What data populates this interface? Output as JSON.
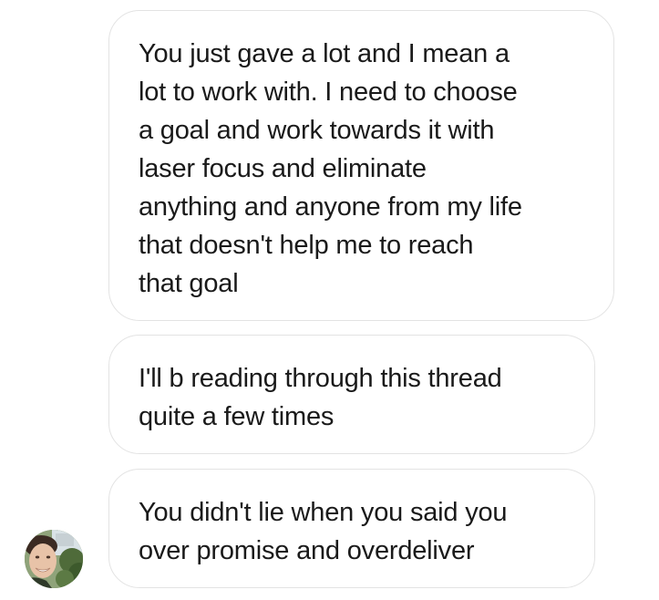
{
  "messages": [
    {
      "text": "You just gave a lot and I mean a\nlot to work with. I need to choose\na goal and work towards it with\nlaser focus and eliminate\nanything and anyone from my life\nthat doesn't help me to reach\nthat goal"
    },
    {
      "text": "I'll b reading through this thread\nquite a few times"
    },
    {
      "text": "You didn't lie when you said you\nover promise and overdeliver"
    }
  ],
  "avatar": {
    "icon": "user-avatar-photo"
  },
  "colors": {
    "bubble_border": "#e3e3e3",
    "text": "#1a1a1a",
    "background": "#ffffff"
  }
}
